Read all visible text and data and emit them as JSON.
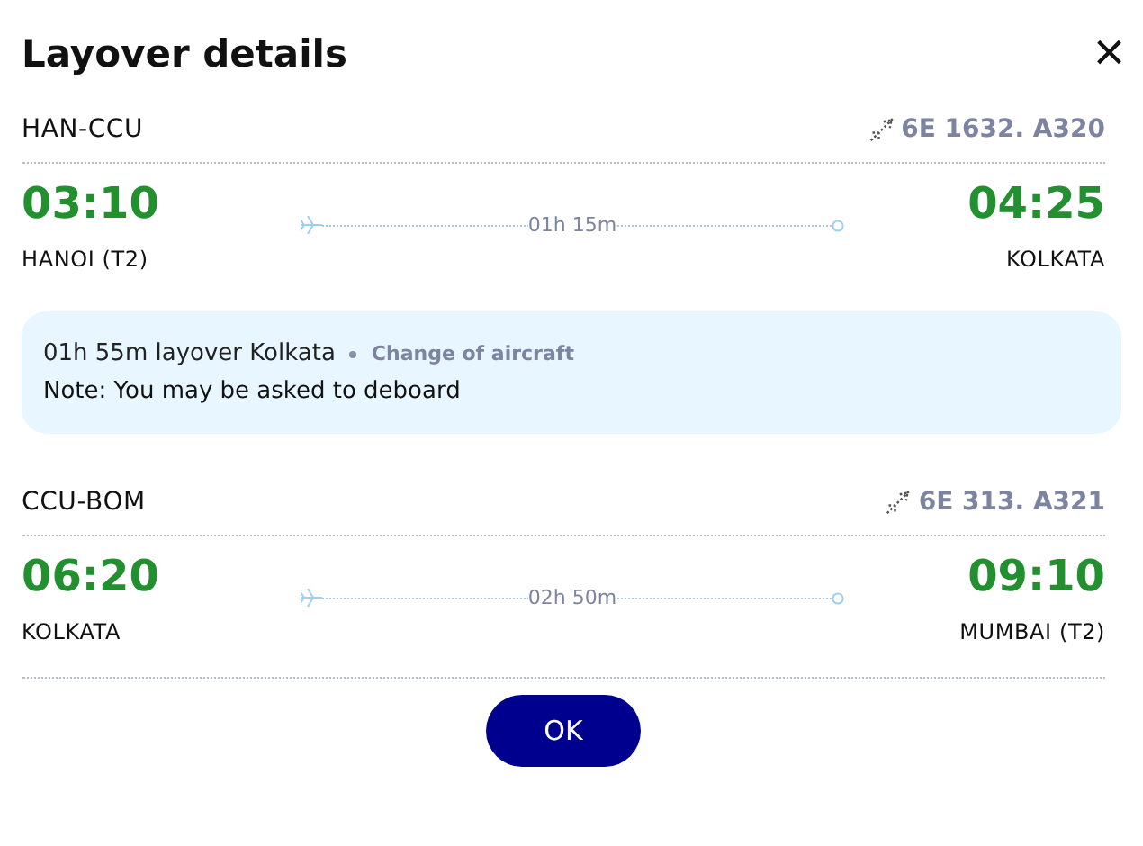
{
  "title": "Layover details",
  "close": "×",
  "segments": [
    {
      "route": "HAN-CCU",
      "flight": "6E 1632. A320",
      "departure": {
        "time": "03:10",
        "city": "HANOI (T2)"
      },
      "duration": "01h 15m",
      "arrival": {
        "time": "04:25",
        "city": "KOLKATA"
      }
    },
    {
      "route": "CCU-BOM",
      "flight": "6E 313. A321",
      "departure": {
        "time": "06:20",
        "city": "KOLKATA"
      },
      "duration": "02h 50m",
      "arrival": {
        "time": "09:10",
        "city": "MUMBAI (T2)"
      }
    }
  ],
  "layover": {
    "summary": "01h 55m layover Kolkata",
    "tag": "Change of aircraft",
    "note": "Note: You may be asked to deboard"
  },
  "button": "OK"
}
